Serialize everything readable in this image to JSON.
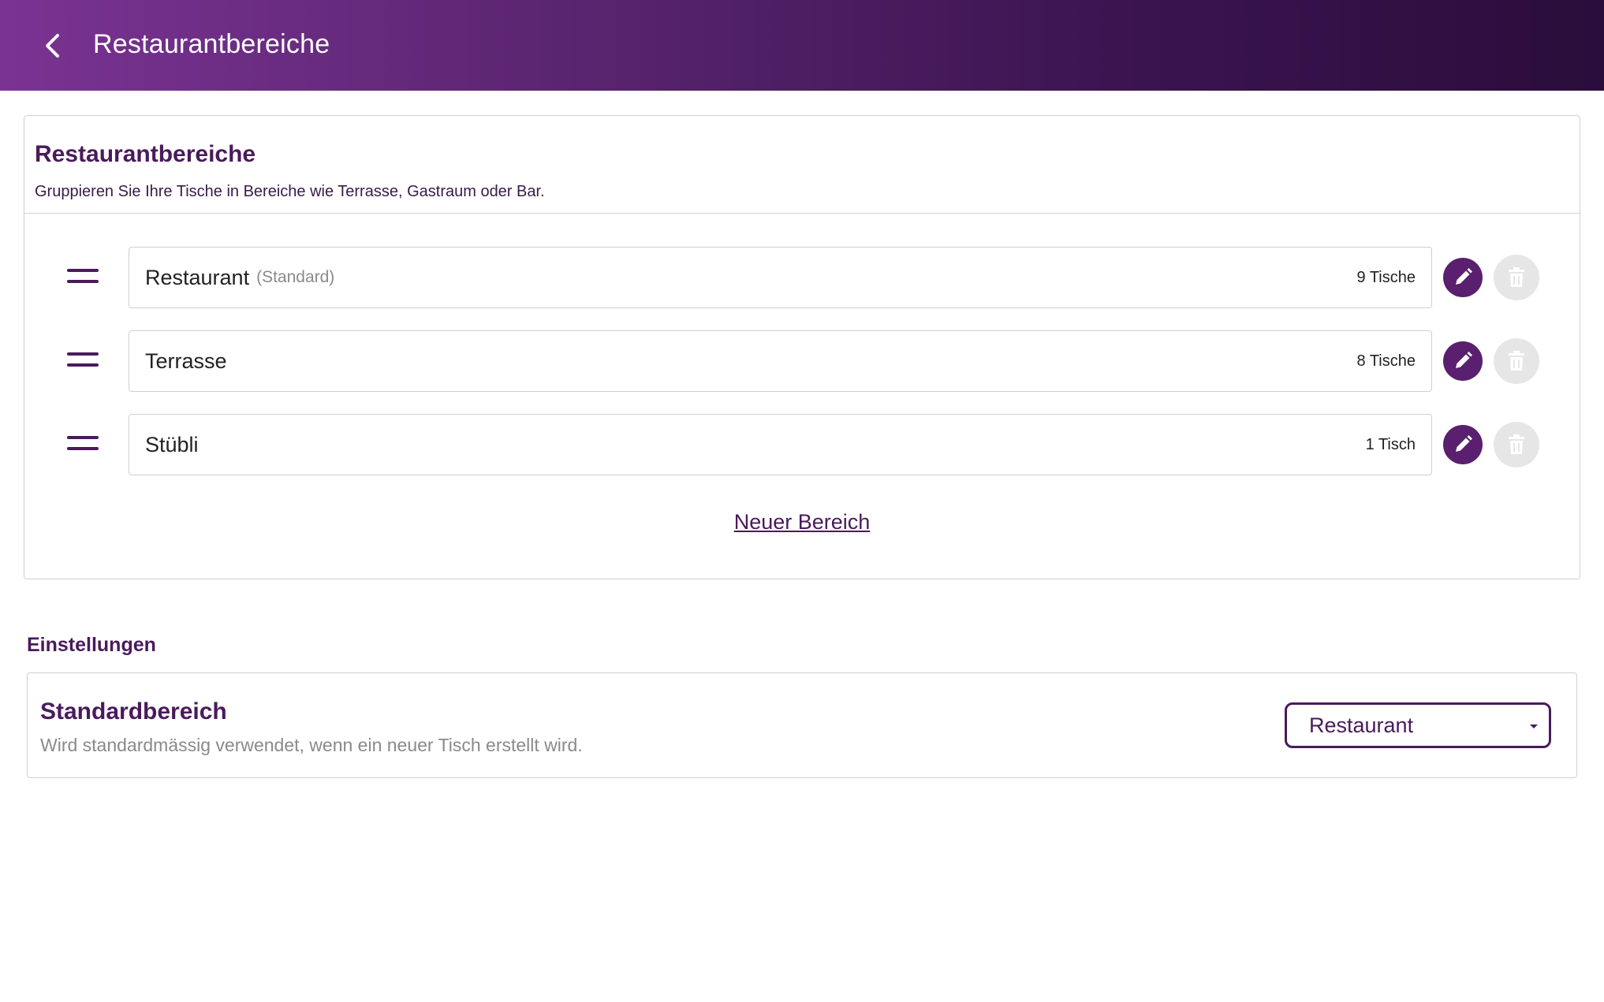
{
  "appbar": {
    "title": "Restaurantbereiche",
    "back_icon": "chevron-left-icon"
  },
  "areas_card": {
    "title": "Restaurantbereiche",
    "subtitle": "Gruppieren Sie Ihre Tische in Bereiche wie Terrasse, Gastraum oder Bar.",
    "rows": [
      {
        "name": "Restaurant",
        "tag": "(Standard)",
        "count": "9 Tische"
      },
      {
        "name": "Terrasse",
        "tag": "",
        "count": "8 Tische"
      },
      {
        "name": "Stübli",
        "tag": "",
        "count": "1 Tisch"
      }
    ],
    "new_area_label": "Neuer Bereich"
  },
  "settings": {
    "section_label": "Einstellungen",
    "default_area": {
      "title": "Standardbereich",
      "description": "Wird standardmässig verwendet, wenn ein neuer Tisch erstellt wird.",
      "selected": "Restaurant"
    }
  },
  "colors": {
    "primary": "#5a1f6e",
    "primary_dark": "#4a1a5c",
    "appbar_start": "#7a3393",
    "appbar_end": "#2a0d3b",
    "disabled": "#e6e6e6"
  }
}
